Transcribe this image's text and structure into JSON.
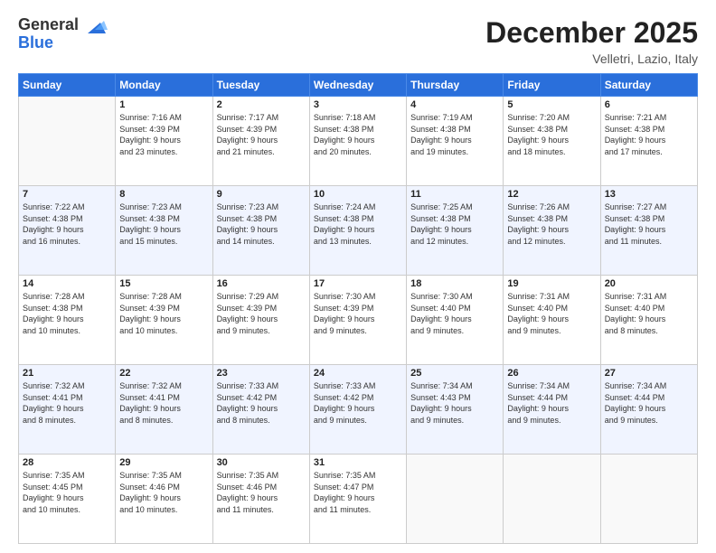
{
  "logo": {
    "general": "General",
    "blue": "Blue"
  },
  "title": "December 2025",
  "location": "Velletri, Lazio, Italy",
  "days_of_week": [
    "Sunday",
    "Monday",
    "Tuesday",
    "Wednesday",
    "Thursday",
    "Friday",
    "Saturday"
  ],
  "weeks": [
    [
      {
        "day": "",
        "info": ""
      },
      {
        "day": "1",
        "info": "Sunrise: 7:16 AM\nSunset: 4:39 PM\nDaylight: 9 hours\nand 23 minutes."
      },
      {
        "day": "2",
        "info": "Sunrise: 7:17 AM\nSunset: 4:39 PM\nDaylight: 9 hours\nand 21 minutes."
      },
      {
        "day": "3",
        "info": "Sunrise: 7:18 AM\nSunset: 4:38 PM\nDaylight: 9 hours\nand 20 minutes."
      },
      {
        "day": "4",
        "info": "Sunrise: 7:19 AM\nSunset: 4:38 PM\nDaylight: 9 hours\nand 19 minutes."
      },
      {
        "day": "5",
        "info": "Sunrise: 7:20 AM\nSunset: 4:38 PM\nDaylight: 9 hours\nand 18 minutes."
      },
      {
        "day": "6",
        "info": "Sunrise: 7:21 AM\nSunset: 4:38 PM\nDaylight: 9 hours\nand 17 minutes."
      }
    ],
    [
      {
        "day": "7",
        "info": "Sunrise: 7:22 AM\nSunset: 4:38 PM\nDaylight: 9 hours\nand 16 minutes."
      },
      {
        "day": "8",
        "info": "Sunrise: 7:23 AM\nSunset: 4:38 PM\nDaylight: 9 hours\nand 15 minutes."
      },
      {
        "day": "9",
        "info": "Sunrise: 7:23 AM\nSunset: 4:38 PM\nDaylight: 9 hours\nand 14 minutes."
      },
      {
        "day": "10",
        "info": "Sunrise: 7:24 AM\nSunset: 4:38 PM\nDaylight: 9 hours\nand 13 minutes."
      },
      {
        "day": "11",
        "info": "Sunrise: 7:25 AM\nSunset: 4:38 PM\nDaylight: 9 hours\nand 12 minutes."
      },
      {
        "day": "12",
        "info": "Sunrise: 7:26 AM\nSunset: 4:38 PM\nDaylight: 9 hours\nand 12 minutes."
      },
      {
        "day": "13",
        "info": "Sunrise: 7:27 AM\nSunset: 4:38 PM\nDaylight: 9 hours\nand 11 minutes."
      }
    ],
    [
      {
        "day": "14",
        "info": "Sunrise: 7:28 AM\nSunset: 4:38 PM\nDaylight: 9 hours\nand 10 minutes."
      },
      {
        "day": "15",
        "info": "Sunrise: 7:28 AM\nSunset: 4:39 PM\nDaylight: 9 hours\nand 10 minutes."
      },
      {
        "day": "16",
        "info": "Sunrise: 7:29 AM\nSunset: 4:39 PM\nDaylight: 9 hours\nand 9 minutes."
      },
      {
        "day": "17",
        "info": "Sunrise: 7:30 AM\nSunset: 4:39 PM\nDaylight: 9 hours\nand 9 minutes."
      },
      {
        "day": "18",
        "info": "Sunrise: 7:30 AM\nSunset: 4:40 PM\nDaylight: 9 hours\nand 9 minutes."
      },
      {
        "day": "19",
        "info": "Sunrise: 7:31 AM\nSunset: 4:40 PM\nDaylight: 9 hours\nand 9 minutes."
      },
      {
        "day": "20",
        "info": "Sunrise: 7:31 AM\nSunset: 4:40 PM\nDaylight: 9 hours\nand 8 minutes."
      }
    ],
    [
      {
        "day": "21",
        "info": "Sunrise: 7:32 AM\nSunset: 4:41 PM\nDaylight: 9 hours\nand 8 minutes."
      },
      {
        "day": "22",
        "info": "Sunrise: 7:32 AM\nSunset: 4:41 PM\nDaylight: 9 hours\nand 8 minutes."
      },
      {
        "day": "23",
        "info": "Sunrise: 7:33 AM\nSunset: 4:42 PM\nDaylight: 9 hours\nand 8 minutes."
      },
      {
        "day": "24",
        "info": "Sunrise: 7:33 AM\nSunset: 4:42 PM\nDaylight: 9 hours\nand 9 minutes."
      },
      {
        "day": "25",
        "info": "Sunrise: 7:34 AM\nSunset: 4:43 PM\nDaylight: 9 hours\nand 9 minutes."
      },
      {
        "day": "26",
        "info": "Sunrise: 7:34 AM\nSunset: 4:44 PM\nDaylight: 9 hours\nand 9 minutes."
      },
      {
        "day": "27",
        "info": "Sunrise: 7:34 AM\nSunset: 4:44 PM\nDaylight: 9 hours\nand 9 minutes."
      }
    ],
    [
      {
        "day": "28",
        "info": "Sunrise: 7:35 AM\nSunset: 4:45 PM\nDaylight: 9 hours\nand 10 minutes."
      },
      {
        "day": "29",
        "info": "Sunrise: 7:35 AM\nSunset: 4:46 PM\nDaylight: 9 hours\nand 10 minutes."
      },
      {
        "day": "30",
        "info": "Sunrise: 7:35 AM\nSunset: 4:46 PM\nDaylight: 9 hours\nand 11 minutes."
      },
      {
        "day": "31",
        "info": "Sunrise: 7:35 AM\nSunset: 4:47 PM\nDaylight: 9 hours\nand 11 minutes."
      },
      {
        "day": "",
        "info": ""
      },
      {
        "day": "",
        "info": ""
      },
      {
        "day": "",
        "info": ""
      }
    ]
  ]
}
